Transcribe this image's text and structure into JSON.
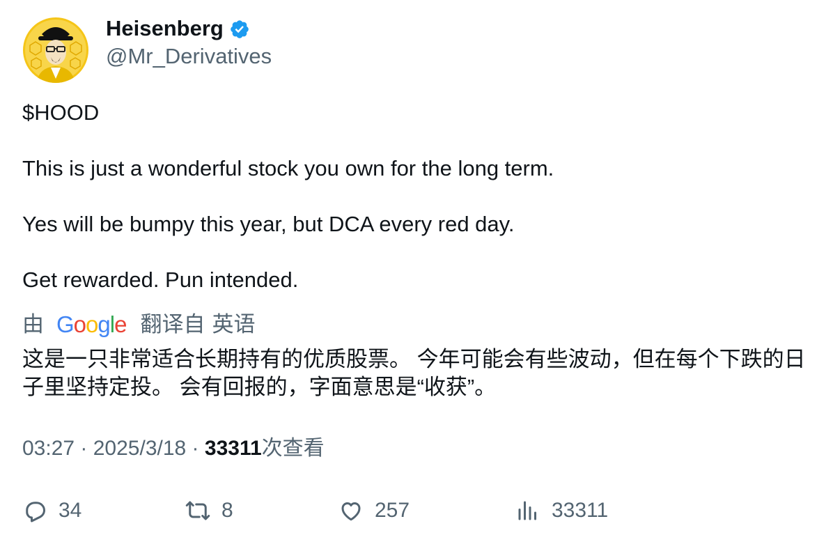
{
  "author": {
    "display_name": "Heisenberg",
    "handle": "@Mr_Derivatives",
    "verified_icon": "verified-badge-icon",
    "verified_color": "#1D9BF0"
  },
  "tweet": {
    "cashtag": "$HOOD",
    "lines": [
      "This is just a wonderful stock you own for the long term.",
      "Yes will be bumpy this year, but DCA every red day.",
      "Get rewarded. Pun intended."
    ]
  },
  "translation": {
    "by_label": "由",
    "provider": "Google",
    "translated_from_label": "翻译自",
    "source_language": "英语",
    "text": "这是一只非常适合长期持有的优质股票。 今年可能会有些波动，但在每个下跌的日子里坚持定投。 会有回报的，字面意思是“收获”。"
  },
  "meta": {
    "time": "03:27",
    "separator": " · ",
    "date": "2025/3/18",
    "views_count": "33311",
    "views_label": "次查看"
  },
  "actions": {
    "replies": "34",
    "retweets": "8",
    "likes": "257",
    "views": "33311"
  },
  "colors": {
    "text_primary": "#0f1419",
    "text_secondary": "#536471",
    "avatar_background": "#F5C518"
  }
}
